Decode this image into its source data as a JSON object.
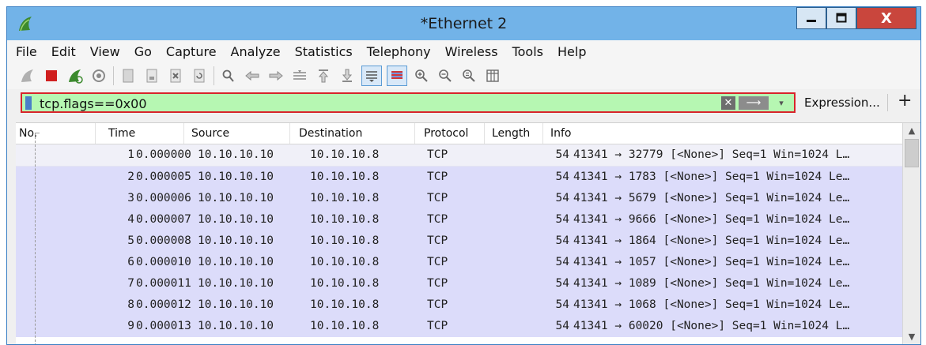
{
  "window": {
    "title": "*Ethernet 2",
    "close_label": "X"
  },
  "menu": [
    "File",
    "Edit",
    "View",
    "Go",
    "Capture",
    "Analyze",
    "Statistics",
    "Telephony",
    "Wireless",
    "Tools",
    "Help"
  ],
  "toolbar": {
    "icons": [
      "start-capture",
      "stop-capture",
      "restart-capture",
      "capture-options",
      "open-file",
      "save-file",
      "close-file",
      "reload-file",
      "find-packet",
      "go-back",
      "go-forward",
      "go-to-packet",
      "go-first",
      "go-last",
      "auto-scroll",
      "colorize",
      "zoom-in",
      "zoom-out",
      "zoom-reset",
      "resize-columns"
    ]
  },
  "filter": {
    "value": "tcp.flags==0x00",
    "expression_label": "Expression...",
    "add_label": "+",
    "clear_label": "✕",
    "apply_label": "⟶",
    "dropdown_label": "▾",
    "valid_color": "#b6f7b2",
    "highlight_color": "#d8242a"
  },
  "packet_list": {
    "columns": [
      "No.",
      "Time",
      "Source",
      "Destination",
      "Protocol",
      "Length",
      "Info"
    ],
    "rows": [
      {
        "no": "1",
        "time": "0.000000",
        "source": "10.10.10.10",
        "destination": "10.10.10.8",
        "protocol": "TCP",
        "length": "54",
        "info": "41341 → 32779 [<None>] Seq=1 Win=1024 L…"
      },
      {
        "no": "2",
        "time": "0.000005",
        "source": "10.10.10.10",
        "destination": "10.10.10.8",
        "protocol": "TCP",
        "length": "54",
        "info": "41341 → 1783 [<None>] Seq=1 Win=1024 Le…"
      },
      {
        "no": "3",
        "time": "0.000006",
        "source": "10.10.10.10",
        "destination": "10.10.10.8",
        "protocol": "TCP",
        "length": "54",
        "info": "41341 → 5679 [<None>] Seq=1 Win=1024 Le…"
      },
      {
        "no": "4",
        "time": "0.000007",
        "source": "10.10.10.10",
        "destination": "10.10.10.8",
        "protocol": "TCP",
        "length": "54",
        "info": "41341 → 9666 [<None>] Seq=1 Win=1024 Le…"
      },
      {
        "no": "5",
        "time": "0.000008",
        "source": "10.10.10.10",
        "destination": "10.10.10.8",
        "protocol": "TCP",
        "length": "54",
        "info": "41341 → 1864 [<None>] Seq=1 Win=1024 Le…"
      },
      {
        "no": "6",
        "time": "0.000010",
        "source": "10.10.10.10",
        "destination": "10.10.10.8",
        "protocol": "TCP",
        "length": "54",
        "info": "41341 → 1057 [<None>] Seq=1 Win=1024 Le…"
      },
      {
        "no": "7",
        "time": "0.000011",
        "source": "10.10.10.10",
        "destination": "10.10.10.8",
        "protocol": "TCP",
        "length": "54",
        "info": "41341 → 1089 [<None>] Seq=1 Win=1024 Le…"
      },
      {
        "no": "8",
        "time": "0.000012",
        "source": "10.10.10.10",
        "destination": "10.10.10.8",
        "protocol": "TCP",
        "length": "54",
        "info": "41341 → 1068 [<None>] Seq=1 Win=1024 Le…"
      },
      {
        "no": "9",
        "time": "0.000013",
        "source": "10.10.10.10",
        "destination": "10.10.10.8",
        "protocol": "TCP",
        "length": "54",
        "info": "41341 → 60020 [<None>] Seq=1 Win=1024 L…"
      }
    ],
    "row_color": "#dcdcfa",
    "selected_row_color": "#f0f0f8"
  }
}
